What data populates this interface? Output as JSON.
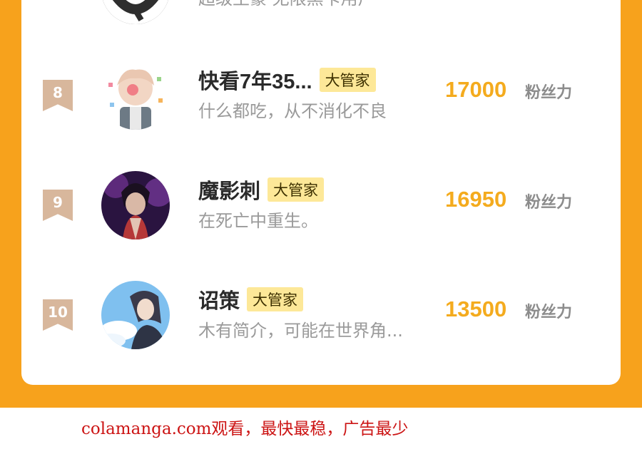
{
  "previous_entry": {
    "bio": "超级土豪 无限黑卡用户"
  },
  "entries": [
    {
      "rank": "8",
      "name": "快看7年35...",
      "badge": "大管家",
      "bio": "什么都吃，从不消化不良",
      "score": "17000",
      "unit": "粉丝力"
    },
    {
      "rank": "9",
      "name": "魔影刺",
      "badge": "大管家",
      "bio": "在死亡中重生。",
      "score": "16950",
      "unit": "粉丝力"
    },
    {
      "rank": "10",
      "name": "诏策",
      "badge": "大管家",
      "bio": "木有简介，可能在世界角...",
      "score": "13500",
      "unit": "粉丝力"
    }
  ],
  "footer": {
    "text": "colamanga.com观看，最快最稳，广告最少"
  },
  "colors": {
    "frame": "#f7a21c",
    "score": "#f4ab1e",
    "badge_bg": "#fde898",
    "rank_ribbon": "#d8b79c",
    "footer_text": "#cc1414"
  }
}
